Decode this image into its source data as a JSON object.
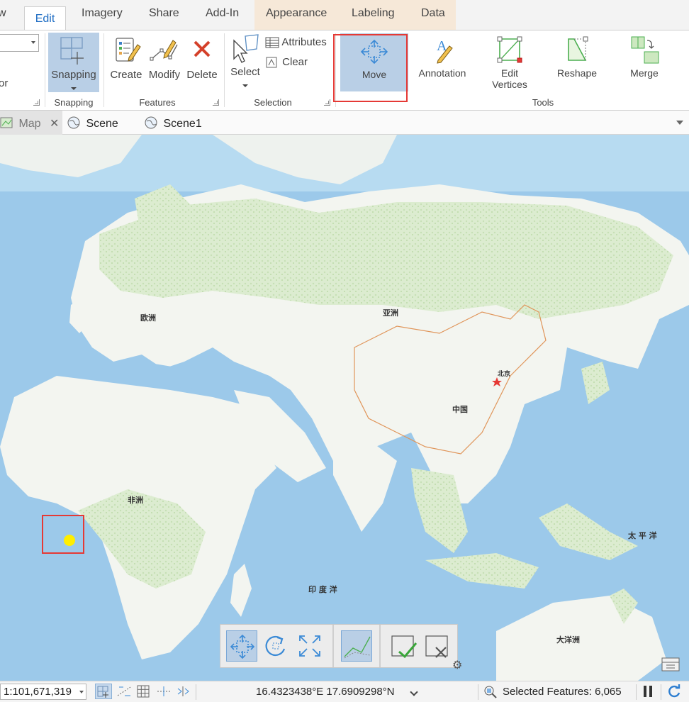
{
  "ribbon": {
    "tabs": [
      "w",
      "Edit",
      "Imagery",
      "Share",
      "Add-In",
      "Appearance",
      "Labeling",
      "Data"
    ],
    "snapping": {
      "button_label": "Snapping",
      "group_label": "Snapping"
    },
    "features": {
      "create": "Create",
      "modify": "Modify",
      "delete": "Delete",
      "group_label": "Features"
    },
    "selection": {
      "select": "Select",
      "attributes": "Attributes",
      "clear": "Clear",
      "group_label": "Selection"
    },
    "tools": {
      "move": "Move",
      "annotation": "Annotation",
      "edit_vertices_1": "Edit",
      "edit_vertices_2": "Vertices",
      "reshape": "Reshape",
      "merge": "Merge",
      "group_label": "Tools"
    },
    "left_fragment": "or"
  },
  "view_tabs": {
    "map": "Map",
    "scene": "Scene",
    "scene1": "Scene1"
  },
  "map_labels": {
    "europe": "欧洲",
    "asia": "亚洲",
    "beijing": "北京",
    "china": "中国",
    "africa": "非洲",
    "pacific": "太 平 洋",
    "indian": "印 度 洋",
    "oceania": "大洋洲"
  },
  "status_bar": {
    "scale": "1:101,671,319",
    "coordinates": "16.4323438°E 17.6909298°N",
    "selected": "Selected Features: 6,065"
  },
  "colors": {
    "ocean": "#9cc9ea",
    "land": "#f4f6f2",
    "vegetation": "#d3e6c7",
    "highlight_box": "#e53935",
    "point": "#ffee00",
    "accent": "#1d6cc3"
  }
}
